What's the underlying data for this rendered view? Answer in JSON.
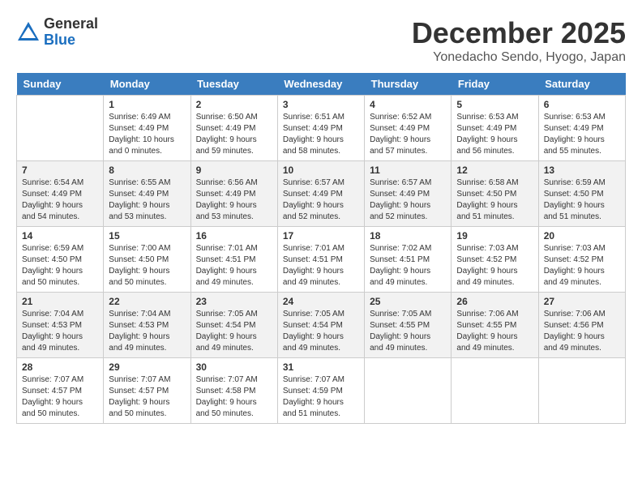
{
  "logo": {
    "general": "General",
    "blue": "Blue"
  },
  "title": "December 2025",
  "location": "Yonedacho Sendo, Hyogo, Japan",
  "days_of_week": [
    "Sunday",
    "Monday",
    "Tuesday",
    "Wednesday",
    "Thursday",
    "Friday",
    "Saturday"
  ],
  "weeks": [
    [
      {
        "day": "",
        "info": ""
      },
      {
        "day": "1",
        "info": "Sunrise: 6:49 AM\nSunset: 4:49 PM\nDaylight: 10 hours\nand 0 minutes."
      },
      {
        "day": "2",
        "info": "Sunrise: 6:50 AM\nSunset: 4:49 PM\nDaylight: 9 hours\nand 59 minutes."
      },
      {
        "day": "3",
        "info": "Sunrise: 6:51 AM\nSunset: 4:49 PM\nDaylight: 9 hours\nand 58 minutes."
      },
      {
        "day": "4",
        "info": "Sunrise: 6:52 AM\nSunset: 4:49 PM\nDaylight: 9 hours\nand 57 minutes."
      },
      {
        "day": "5",
        "info": "Sunrise: 6:53 AM\nSunset: 4:49 PM\nDaylight: 9 hours\nand 56 minutes."
      },
      {
        "day": "6",
        "info": "Sunrise: 6:53 AM\nSunset: 4:49 PM\nDaylight: 9 hours\nand 55 minutes."
      }
    ],
    [
      {
        "day": "7",
        "info": "Sunrise: 6:54 AM\nSunset: 4:49 PM\nDaylight: 9 hours\nand 54 minutes."
      },
      {
        "day": "8",
        "info": "Sunrise: 6:55 AM\nSunset: 4:49 PM\nDaylight: 9 hours\nand 53 minutes."
      },
      {
        "day": "9",
        "info": "Sunrise: 6:56 AM\nSunset: 4:49 PM\nDaylight: 9 hours\nand 53 minutes."
      },
      {
        "day": "10",
        "info": "Sunrise: 6:57 AM\nSunset: 4:49 PM\nDaylight: 9 hours\nand 52 minutes."
      },
      {
        "day": "11",
        "info": "Sunrise: 6:57 AM\nSunset: 4:49 PM\nDaylight: 9 hours\nand 52 minutes."
      },
      {
        "day": "12",
        "info": "Sunrise: 6:58 AM\nSunset: 4:50 PM\nDaylight: 9 hours\nand 51 minutes."
      },
      {
        "day": "13",
        "info": "Sunrise: 6:59 AM\nSunset: 4:50 PM\nDaylight: 9 hours\nand 51 minutes."
      }
    ],
    [
      {
        "day": "14",
        "info": "Sunrise: 6:59 AM\nSunset: 4:50 PM\nDaylight: 9 hours\nand 50 minutes."
      },
      {
        "day": "15",
        "info": "Sunrise: 7:00 AM\nSunset: 4:50 PM\nDaylight: 9 hours\nand 50 minutes."
      },
      {
        "day": "16",
        "info": "Sunrise: 7:01 AM\nSunset: 4:51 PM\nDaylight: 9 hours\nand 49 minutes."
      },
      {
        "day": "17",
        "info": "Sunrise: 7:01 AM\nSunset: 4:51 PM\nDaylight: 9 hours\nand 49 minutes."
      },
      {
        "day": "18",
        "info": "Sunrise: 7:02 AM\nSunset: 4:51 PM\nDaylight: 9 hours\nand 49 minutes."
      },
      {
        "day": "19",
        "info": "Sunrise: 7:03 AM\nSunset: 4:52 PM\nDaylight: 9 hours\nand 49 minutes."
      },
      {
        "day": "20",
        "info": "Sunrise: 7:03 AM\nSunset: 4:52 PM\nDaylight: 9 hours\nand 49 minutes."
      }
    ],
    [
      {
        "day": "21",
        "info": "Sunrise: 7:04 AM\nSunset: 4:53 PM\nDaylight: 9 hours\nand 49 minutes."
      },
      {
        "day": "22",
        "info": "Sunrise: 7:04 AM\nSunset: 4:53 PM\nDaylight: 9 hours\nand 49 minutes."
      },
      {
        "day": "23",
        "info": "Sunrise: 7:05 AM\nSunset: 4:54 PM\nDaylight: 9 hours\nand 49 minutes."
      },
      {
        "day": "24",
        "info": "Sunrise: 7:05 AM\nSunset: 4:54 PM\nDaylight: 9 hours\nand 49 minutes."
      },
      {
        "day": "25",
        "info": "Sunrise: 7:05 AM\nSunset: 4:55 PM\nDaylight: 9 hours\nand 49 minutes."
      },
      {
        "day": "26",
        "info": "Sunrise: 7:06 AM\nSunset: 4:55 PM\nDaylight: 9 hours\nand 49 minutes."
      },
      {
        "day": "27",
        "info": "Sunrise: 7:06 AM\nSunset: 4:56 PM\nDaylight: 9 hours\nand 49 minutes."
      }
    ],
    [
      {
        "day": "28",
        "info": "Sunrise: 7:07 AM\nSunset: 4:57 PM\nDaylight: 9 hours\nand 50 minutes."
      },
      {
        "day": "29",
        "info": "Sunrise: 7:07 AM\nSunset: 4:57 PM\nDaylight: 9 hours\nand 50 minutes."
      },
      {
        "day": "30",
        "info": "Sunrise: 7:07 AM\nSunset: 4:58 PM\nDaylight: 9 hours\nand 50 minutes."
      },
      {
        "day": "31",
        "info": "Sunrise: 7:07 AM\nSunset: 4:59 PM\nDaylight: 9 hours\nand 51 minutes."
      },
      {
        "day": "",
        "info": ""
      },
      {
        "day": "",
        "info": ""
      },
      {
        "day": "",
        "info": ""
      }
    ]
  ]
}
